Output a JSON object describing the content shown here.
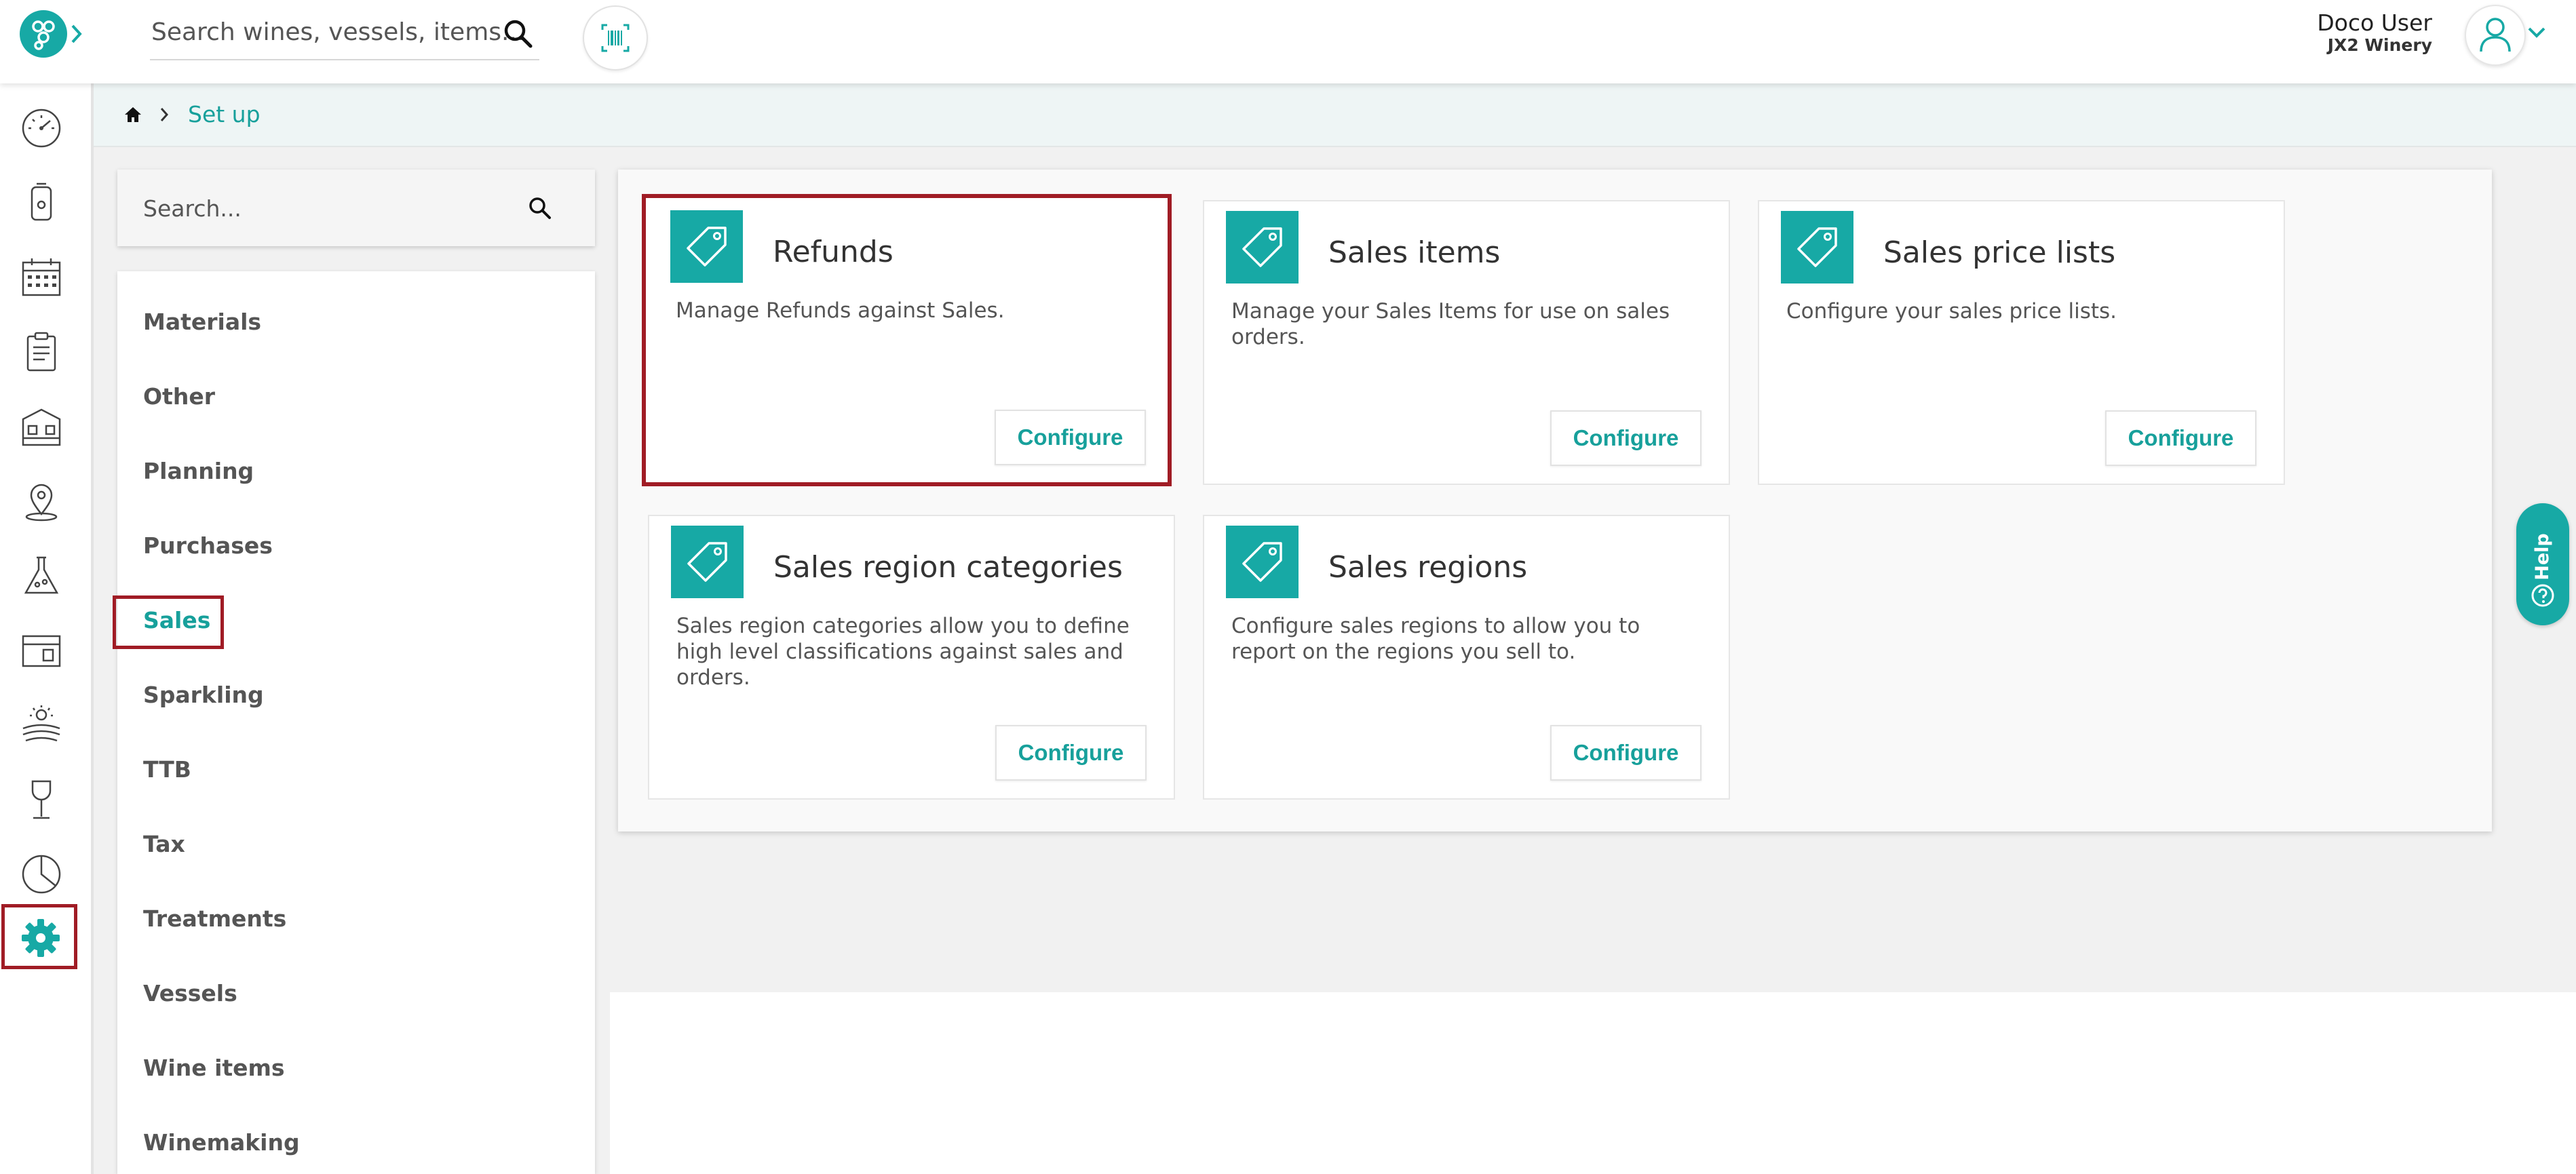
{
  "header": {
    "search_placeholder": "Search wines, vessels, items...",
    "user_name": "Doco User",
    "user_org": "JX2 Winery"
  },
  "breadcrumb": {
    "current": "Set up"
  },
  "filter": {
    "search_placeholder": "Search..."
  },
  "categories": [
    {
      "label": "Materials"
    },
    {
      "label": "Other"
    },
    {
      "label": "Planning"
    },
    {
      "label": "Purchases"
    },
    {
      "label": "Sales",
      "active": true
    },
    {
      "label": "Sparkling"
    },
    {
      "label": "TTB"
    },
    {
      "label": "Tax"
    },
    {
      "label": "Treatments"
    },
    {
      "label": "Vessels"
    },
    {
      "label": "Wine items"
    },
    {
      "label": "Winemaking"
    }
  ],
  "cards": [
    {
      "title": "Refunds",
      "description": "Manage Refunds against Sales.",
      "button": "Configure",
      "icon": "tag-icon"
    },
    {
      "title": "Sales items",
      "description": "Manage your Sales Items for use on sales orders.",
      "button": "Configure",
      "icon": "tag-icon"
    },
    {
      "title": "Sales price lists",
      "description": "Configure your sales price lists.",
      "button": "Configure",
      "icon": "tag-icon"
    },
    {
      "title": "Sales region categories",
      "description": "Sales region categories allow you to define high level classifications against sales and orders.",
      "button": "Configure",
      "icon": "tag-icon"
    },
    {
      "title": "Sales regions",
      "description": "Configure sales regions to allow you to report on the regions you sell to.",
      "button": "Configure",
      "icon": "tag-icon"
    }
  ],
  "help": {
    "label": "Help"
  },
  "colors": {
    "accent": "#17a9a5",
    "highlight": "#a01c25"
  }
}
